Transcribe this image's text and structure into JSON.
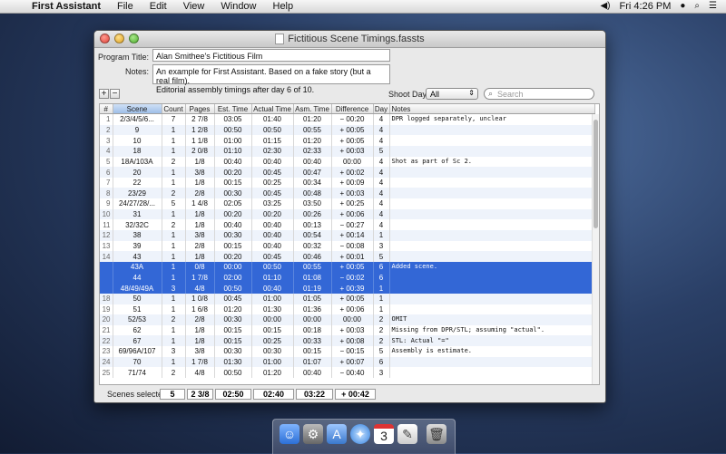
{
  "menubar": {
    "app_name": "First Assistant",
    "items": [
      "File",
      "Edit",
      "View",
      "Window",
      "Help"
    ],
    "clock": "Fri 4:26 PM"
  },
  "window": {
    "title": "Fictitious Scene Timings.fassts"
  },
  "form": {
    "program_title_label": "Program Title:",
    "program_title_value": "Alan Smithee's Fictitious Film",
    "notes_label": "Notes:",
    "notes_line1": "An example for First Assistant.  Based on a fake story (but a real film).",
    "notes_line2": "Editorial assembly timings after day 6 of 10."
  },
  "toolbar": {
    "add_label": "+",
    "remove_label": "−",
    "shoot_day_label": "Shoot Day:",
    "shoot_day_value": "All",
    "search_placeholder": "Search"
  },
  "table": {
    "headers": [
      "#",
      "Scene",
      "Count",
      "Pages",
      "Est. Time",
      "Actual Time",
      "Asm. Time",
      "Difference",
      "Day",
      "Notes"
    ],
    "rows": [
      {
        "n": "1",
        "scene": "2/3/4/5/6...",
        "count": "7",
        "pages": "2 7/8",
        "est": "03:05",
        "actual": "01:40",
        "asm": "01:20",
        "diff": "− 00:20",
        "day": "4",
        "notes": "DPR logged separately, unclear"
      },
      {
        "n": "2",
        "scene": "9",
        "count": "1",
        "pages": "1 2/8",
        "est": "00:50",
        "actual": "00:50",
        "asm": "00:55",
        "diff": "+ 00:05",
        "day": "4",
        "notes": ""
      },
      {
        "n": "3",
        "scene": "10",
        "count": "1",
        "pages": "1 1/8",
        "est": "01:00",
        "actual": "01:15",
        "asm": "01:20",
        "diff": "+ 00:05",
        "day": "4",
        "notes": ""
      },
      {
        "n": "4",
        "scene": "18",
        "count": "1",
        "pages": "2 0/8",
        "est": "01:10",
        "actual": "02:30",
        "asm": "02:33",
        "diff": "+ 00:03",
        "day": "5",
        "notes": ""
      },
      {
        "n": "5",
        "scene": "18A/103A",
        "count": "2",
        "pages": "1/8",
        "est": "00:40",
        "actual": "00:40",
        "asm": "00:40",
        "diff": "00:00",
        "day": "4",
        "notes": "Shot as part of Sc 2."
      },
      {
        "n": "6",
        "scene": "20",
        "count": "1",
        "pages": "3/8",
        "est": "00:20",
        "actual": "00:45",
        "asm": "00:47",
        "diff": "+ 00:02",
        "day": "4",
        "notes": ""
      },
      {
        "n": "7",
        "scene": "22",
        "count": "1",
        "pages": "1/8",
        "est": "00:15",
        "actual": "00:25",
        "asm": "00:34",
        "diff": "+ 00:09",
        "day": "4",
        "notes": ""
      },
      {
        "n": "8",
        "scene": "23/29",
        "count": "2",
        "pages": "2/8",
        "est": "00:30",
        "actual": "00:45",
        "asm": "00:48",
        "diff": "+ 00:03",
        "day": "4",
        "notes": ""
      },
      {
        "n": "9",
        "scene": "24/27/28/...",
        "count": "5",
        "pages": "1 4/8",
        "est": "02:05",
        "actual": "03:25",
        "asm": "03:50",
        "diff": "+ 00:25",
        "day": "4",
        "notes": ""
      },
      {
        "n": "10",
        "scene": "31",
        "count": "1",
        "pages": "1/8",
        "est": "00:20",
        "actual": "00:20",
        "asm": "00:26",
        "diff": "+ 00:06",
        "day": "4",
        "notes": ""
      },
      {
        "n": "11",
        "scene": "32/32C",
        "count": "2",
        "pages": "1/8",
        "est": "00:40",
        "actual": "00:40",
        "asm": "00:13",
        "diff": "− 00:27",
        "day": "4",
        "notes": ""
      },
      {
        "n": "12",
        "scene": "38",
        "count": "1",
        "pages": "3/8",
        "est": "00:30",
        "actual": "00:40",
        "asm": "00:54",
        "diff": "+ 00:14",
        "day": "1",
        "notes": ""
      },
      {
        "n": "13",
        "scene": "39",
        "count": "1",
        "pages": "2/8",
        "est": "00:15",
        "actual": "00:40",
        "asm": "00:32",
        "diff": "− 00:08",
        "day": "3",
        "notes": ""
      },
      {
        "n": "14",
        "scene": "43",
        "count": "1",
        "pages": "1/8",
        "est": "00:20",
        "actual": "00:45",
        "asm": "00:46",
        "diff": "+ 00:01",
        "day": "5",
        "notes": ""
      },
      {
        "n": "",
        "scene": "43A",
        "count": "1",
        "pages": "0/8",
        "est": "00:00",
        "actual": "00:50",
        "asm": "00:55",
        "diff": "+ 00:05",
        "day": "6",
        "notes": "Added scene.",
        "selected": true
      },
      {
        "n": "",
        "scene": "44",
        "count": "1",
        "pages": "1 7/8",
        "est": "02:00",
        "actual": "01:10",
        "asm": "01:08",
        "diff": "− 00:02",
        "day": "6",
        "notes": "",
        "selected": true
      },
      {
        "n": "",
        "scene": "48/49/49A",
        "count": "3",
        "pages": "4/8",
        "est": "00:50",
        "actual": "00:40",
        "asm": "01:19",
        "diff": "+ 00:39",
        "day": "1",
        "notes": "",
        "selected": true
      },
      {
        "n": "18",
        "scene": "50",
        "count": "1",
        "pages": "1 0/8",
        "est": "00:45",
        "actual": "01:00",
        "asm": "01:05",
        "diff": "+ 00:05",
        "day": "1",
        "notes": ""
      },
      {
        "n": "19",
        "scene": "51",
        "count": "1",
        "pages": "1 6/8",
        "est": "01:20",
        "actual": "01:30",
        "asm": "01:36",
        "diff": "+ 00:06",
        "day": "1",
        "notes": ""
      },
      {
        "n": "20",
        "scene": "52/53",
        "count": "2",
        "pages": "2/8",
        "est": "00:30",
        "actual": "00:00",
        "asm": "00:00",
        "diff": "00:00",
        "day": "2",
        "notes": "OMIT"
      },
      {
        "n": "21",
        "scene": "62",
        "count": "1",
        "pages": "1/8",
        "est": "00:15",
        "actual": "00:15",
        "asm": "00:18",
        "diff": "+ 00:03",
        "day": "2",
        "notes": "Missing from DPR/STL; assuming \"actual\"."
      },
      {
        "n": "22",
        "scene": "67",
        "count": "1",
        "pages": "1/8",
        "est": "00:15",
        "actual": "00:25",
        "asm": "00:33",
        "diff": "+ 00:08",
        "day": "2",
        "notes": "STL: Actual \"=\""
      },
      {
        "n": "23",
        "scene": "69/96A/107",
        "count": "3",
        "pages": "3/8",
        "est": "00:30",
        "actual": "00:30",
        "asm": "00:15",
        "diff": "− 00:15",
        "day": "5",
        "notes": "Assembly is estimate."
      },
      {
        "n": "24",
        "scene": "70",
        "count": "1",
        "pages": "1 7/8",
        "est": "01:30",
        "actual": "01:00",
        "asm": "01:07",
        "diff": "+ 00:07",
        "day": "6",
        "notes": ""
      },
      {
        "n": "25",
        "scene": "71/74",
        "count": "2",
        "pages": "4/8",
        "est": "00:50",
        "actual": "01:20",
        "asm": "00:40",
        "diff": "− 00:40",
        "day": "3",
        "notes": ""
      }
    ]
  },
  "footer": {
    "label": "Scenes selected:",
    "count": "5",
    "pages": "2 3/8",
    "est": "02:50",
    "actual": "02:40",
    "asm": "03:22",
    "diff": "+ 00:42"
  },
  "colors": {
    "selection": "#3367d6",
    "alt_row": "#eef3fb"
  },
  "dock": {
    "icons": [
      "finder-icon",
      "system-prefs-icon",
      "first-assistant-icon",
      "safari-icon",
      "calendar-icon",
      "textedit-icon",
      "trash-icon"
    ],
    "calendar_day": "3"
  }
}
